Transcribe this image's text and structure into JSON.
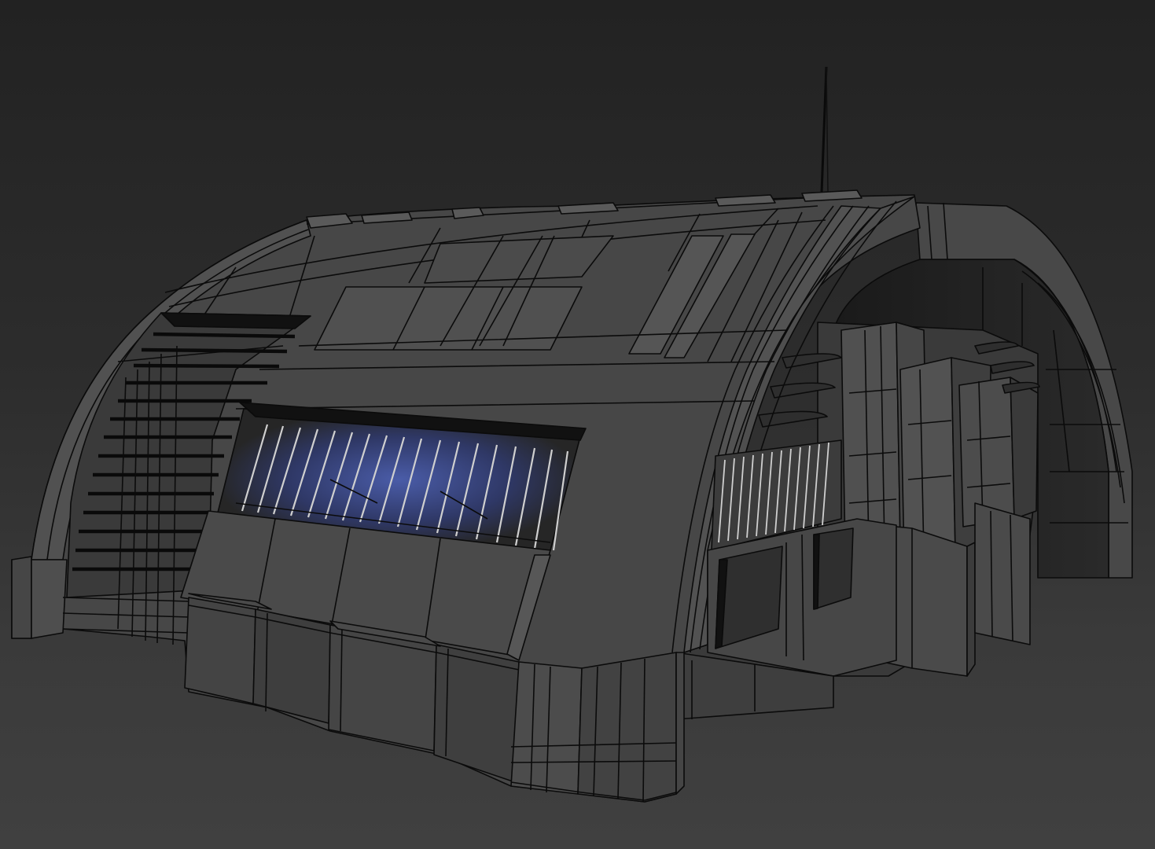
{
  "scene": {
    "view": "3d-perspective-viewport",
    "render_mode": "shaded-with-wireframe",
    "object": "sci-fi-quonset-hangar",
    "colors": {
      "background_top": "#222222",
      "background_bottom": "#404040",
      "mesh_face": "#4a4a4a",
      "mesh_face_dark": "#2a2a2a",
      "mesh_face_light": "#5a5a5a",
      "wire": "#0b0b0b",
      "highlight_blue": "#3e4d8a",
      "interior": "#1c1c1c"
    }
  }
}
